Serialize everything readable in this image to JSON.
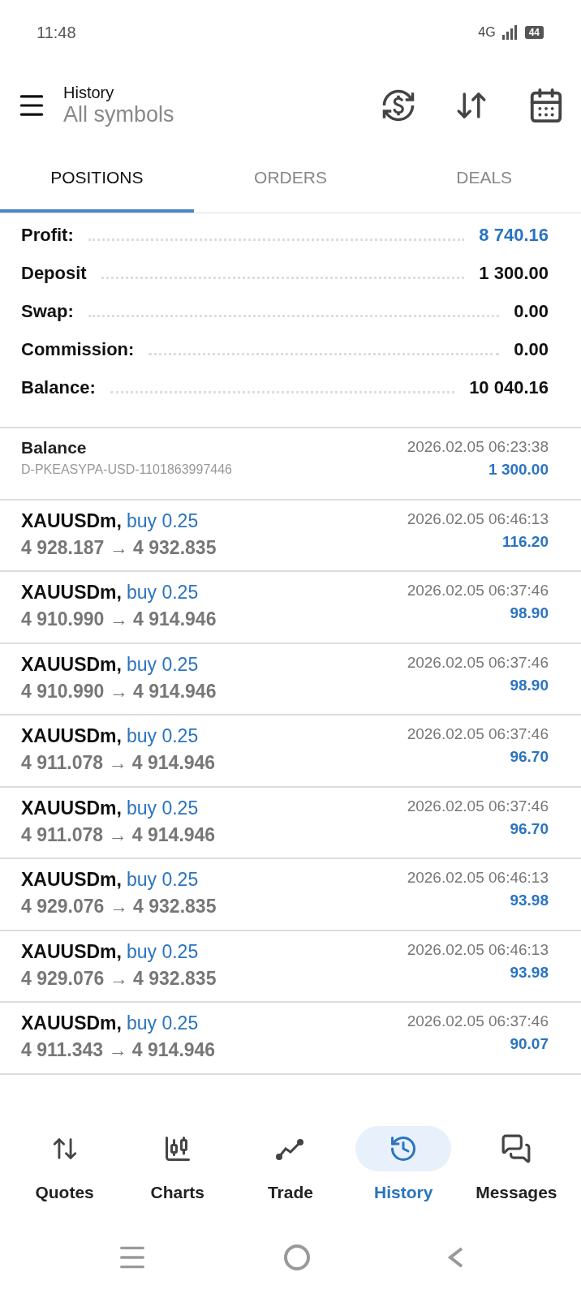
{
  "status_bar": {
    "time": "11:48",
    "network": "4G",
    "battery": "44"
  },
  "header": {
    "title": "History",
    "subtitle": "All symbols"
  },
  "tabs": [
    {
      "label": "POSITIONS",
      "selected": true
    },
    {
      "label": "ORDERS",
      "selected": false
    },
    {
      "label": "DEALS",
      "selected": false
    }
  ],
  "summary": [
    {
      "label": "Profit:",
      "value": "8 740.16",
      "highlight": true
    },
    {
      "label": "Deposit",
      "value": "1 300.00",
      "highlight": false
    },
    {
      "label": "Swap:",
      "value": "0.00",
      "highlight": false
    },
    {
      "label": "Commission:",
      "value": "0.00",
      "highlight": false
    },
    {
      "label": "Balance:",
      "value": "10 040.16",
      "highlight": false
    }
  ],
  "rows": [
    {
      "kind": "balance",
      "title": "Balance",
      "detail": "D-PKEASYPA-USD-1101863997446",
      "time": "2026.02.05 06:23:38",
      "amount": "1 300.00"
    },
    {
      "kind": "deal",
      "symbol": "XAUUSDm,",
      "side": "buy 0.25",
      "prices": "4 928.187 → 4 932.835",
      "time": "2026.02.05 06:46:13",
      "amount": "116.20"
    },
    {
      "kind": "deal",
      "symbol": "XAUUSDm,",
      "side": "buy 0.25",
      "prices": "4 910.990 → 4 914.946",
      "time": "2026.02.05 06:37:46",
      "amount": "98.90"
    },
    {
      "kind": "deal",
      "symbol": "XAUUSDm,",
      "side": "buy 0.25",
      "prices": "4 910.990 → 4 914.946",
      "time": "2026.02.05 06:37:46",
      "amount": "98.90"
    },
    {
      "kind": "deal",
      "symbol": "XAUUSDm,",
      "side": "buy 0.25",
      "prices": "4 911.078 → 4 914.946",
      "time": "2026.02.05 06:37:46",
      "amount": "96.70"
    },
    {
      "kind": "deal",
      "symbol": "XAUUSDm,",
      "side": "buy 0.25",
      "prices": "4 911.078 → 4 914.946",
      "time": "2026.02.05 06:37:46",
      "amount": "96.70"
    },
    {
      "kind": "deal",
      "symbol": "XAUUSDm,",
      "side": "buy 0.25",
      "prices": "4 929.076 → 4 932.835",
      "time": "2026.02.05 06:46:13",
      "amount": "93.98"
    },
    {
      "kind": "deal",
      "symbol": "XAUUSDm,",
      "side": "buy 0.25",
      "prices": "4 929.076 → 4 932.835",
      "time": "2026.02.05 06:46:13",
      "amount": "93.98"
    },
    {
      "kind": "deal",
      "symbol": "XAUUSDm,",
      "side": "buy 0.25",
      "prices": "4 911.343 → 4 914.946",
      "time": "2026.02.05 06:37:46",
      "amount": "90.07"
    }
  ],
  "bottom_nav": [
    {
      "kind": "quotes",
      "label": "Quotes",
      "selected": false
    },
    {
      "kind": "charts",
      "label": "Charts",
      "selected": false
    },
    {
      "kind": "trade",
      "label": "Trade",
      "selected": false
    },
    {
      "kind": "history",
      "label": "History",
      "selected": true
    },
    {
      "kind": "messages",
      "label": "Messages",
      "selected": false
    }
  ]
}
